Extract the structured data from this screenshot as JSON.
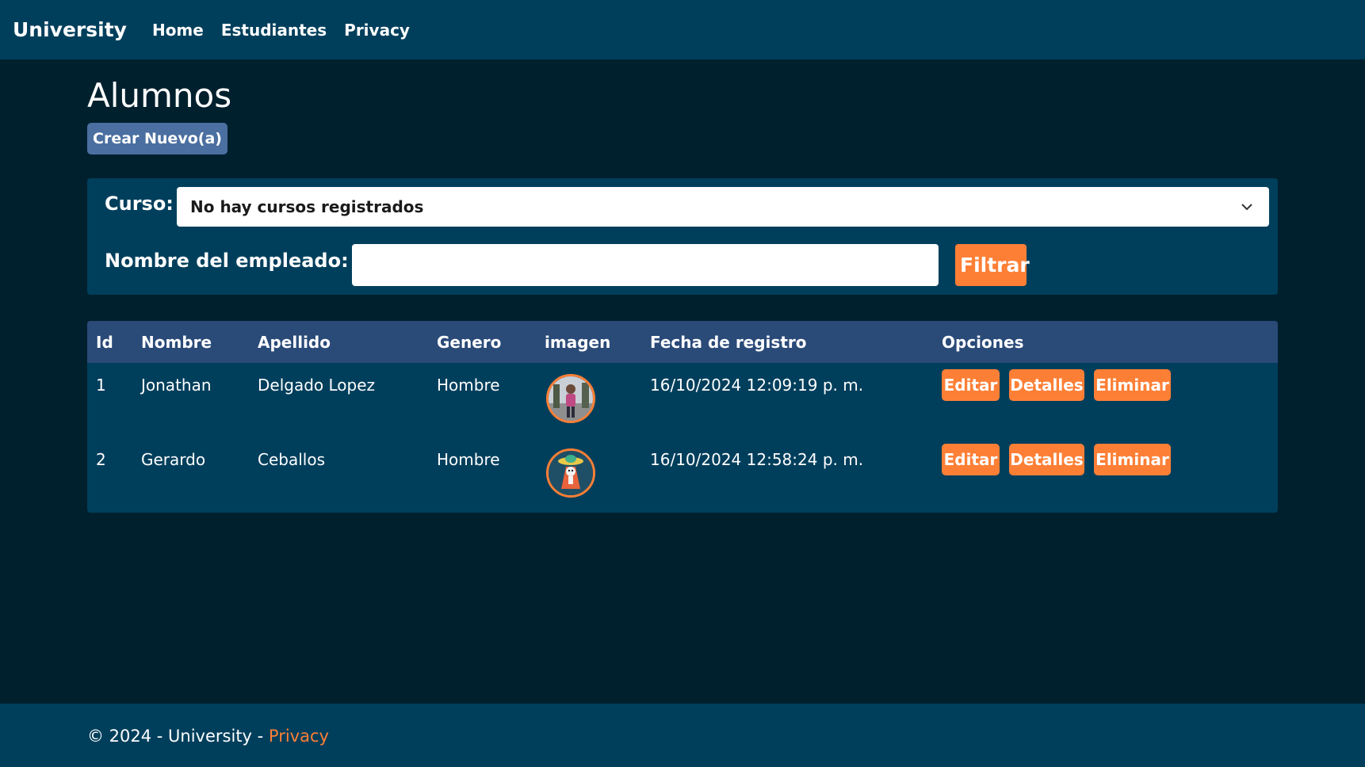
{
  "navbar": {
    "brand": "University",
    "links": [
      {
        "label": "Home"
      },
      {
        "label": "Estudiantes"
      },
      {
        "label": "Privacy"
      }
    ]
  },
  "page": {
    "title": "Alumnos",
    "create_label": "Crear Nuevo(a)"
  },
  "filter": {
    "curso_label": "Curso:",
    "curso_selected": "No hay cursos registrados",
    "empleado_label": "Nombre del empleado:",
    "empleado_value": "",
    "filter_label": "Filtrar"
  },
  "table": {
    "headers": [
      "Id",
      "Nombre",
      "Apellido",
      "Genero",
      "imagen",
      "Fecha de registro",
      "Opciones"
    ],
    "rows": [
      {
        "id": "1",
        "nombre": "Jonathan",
        "apellido": "Delgado Lopez",
        "genero": "Hombre",
        "imagen": "person-photo-avatar",
        "fecha": "16/10/2024 12:09:19 p. m.",
        "edit_label": "Editar",
        "details_label": "Detalles",
        "delete_label": "Eliminar"
      },
      {
        "id": "2",
        "nombre": "Gerardo",
        "apellido": "Ceballos",
        "genero": "Hombre",
        "imagen": "cartoon-character-avatar",
        "fecha": "16/10/2024 12:58:24 p. m.",
        "edit_label": "Editar",
        "details_label": "Detalles",
        "delete_label": "Eliminar"
      }
    ]
  },
  "footer": {
    "text": "© 2024 - University - ",
    "link": "Privacy"
  },
  "colors": {
    "nav_bg": "#003f5c",
    "page_bg": "#00202e",
    "accent": "#fd7f36",
    "table_header_bg": "#2a4a78",
    "create_button_bg": "#4a6fa0"
  }
}
